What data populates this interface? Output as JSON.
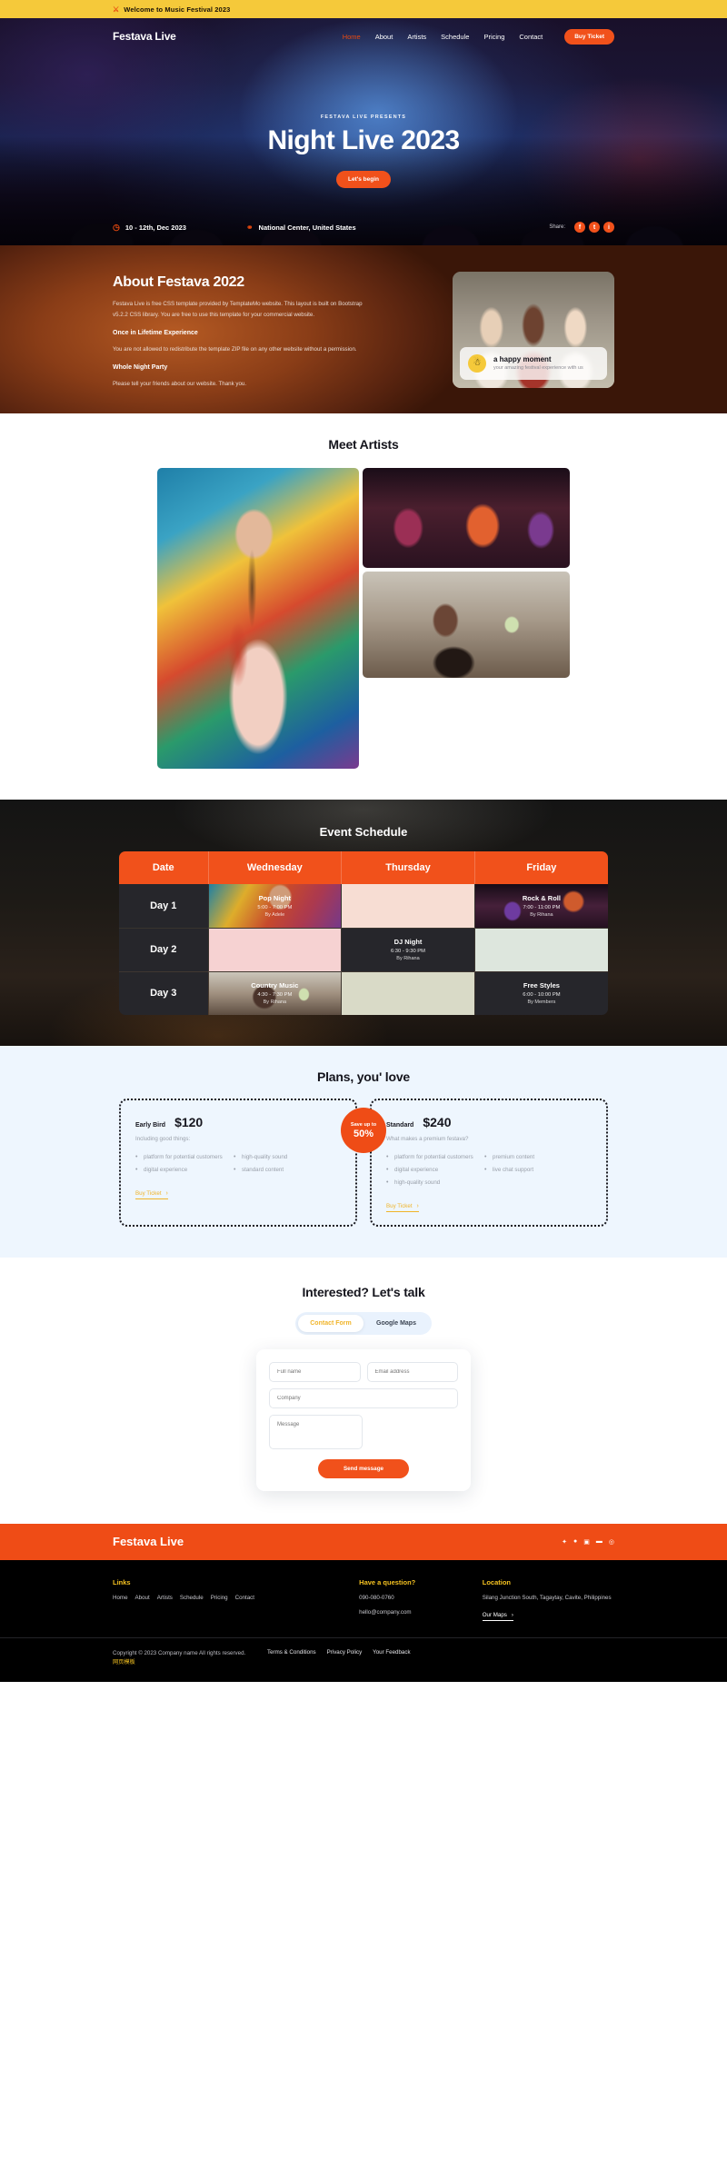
{
  "topbar": {
    "icon": "ticket-icon",
    "text": "Welcome to Music Festival 2023"
  },
  "nav": {
    "brand": "Festava Live",
    "items": [
      {
        "label": "Home",
        "active": true
      },
      {
        "label": "About",
        "active": false
      },
      {
        "label": "Artists",
        "active": false
      },
      {
        "label": "Schedule",
        "active": false
      },
      {
        "label": "Pricing",
        "active": false
      },
      {
        "label": "Contact",
        "active": false
      }
    ],
    "cta": "Buy Ticket"
  },
  "hero": {
    "kicker": "FESTAVA LIVE PRESENTS",
    "title": "Night Live 2023",
    "cta": "Let's begin",
    "date": "10 - 12th, Dec 2023",
    "location": "National Center, United States",
    "share_label": "Share:",
    "socials": [
      "f",
      "t",
      "i"
    ]
  },
  "about": {
    "heading": "About Festava 2022",
    "paragraph": "Festava Live is free CSS template provided by TemplateMo website. This layout is built on Bootstrap v5.2.2 CSS library. You are free to use this template for your commercial website.",
    "sub1_title": "Once in Lifetime Experience",
    "sub1_text": "You are not allowed to redistribute the template ZIP file on any other website without a permission.",
    "sub2_title": "Whole Night Party",
    "sub2_text": "Please tell your friends about our website. Thank you.",
    "card_title": "a happy moment",
    "card_sub": "your amazing festival experience with us",
    "card_icon": "person-icon"
  },
  "artists": {
    "title": "Meet Artists"
  },
  "schedule": {
    "title": "Event Schedule",
    "columns": [
      "Date",
      "Wednesday",
      "Thursday",
      "Friday"
    ],
    "rows": [
      {
        "day": "Day 1",
        "cells": [
          {
            "title": "Pop Night",
            "time": "5:00 - 7:00 PM",
            "by": "By Adele",
            "style": "bg-pop"
          },
          {
            "title": "",
            "time": "",
            "by": "",
            "style": "ph-1"
          },
          {
            "title": "Rock & Roll",
            "time": "7:00 - 11:00 PM",
            "by": "By Rihana",
            "style": "bg-rock"
          }
        ]
      },
      {
        "day": "Day 2",
        "cells": [
          {
            "title": "",
            "time": "",
            "by": "",
            "style": "ph-2"
          },
          {
            "title": "DJ Night",
            "time": "6:30 - 9:30 PM",
            "by": "By Rihana",
            "style": ""
          },
          {
            "title": "",
            "time": "",
            "by": "",
            "style": "ph-3"
          }
        ]
      },
      {
        "day": "Day 3",
        "cells": [
          {
            "title": "Country Music",
            "time": "4:30 - 7:30 PM",
            "by": "By Rihana",
            "style": "bg-country"
          },
          {
            "title": "",
            "time": "",
            "by": "",
            "style": "ph-4"
          },
          {
            "title": "Free Styles",
            "time": "6:00 - 10:00 PM",
            "by": "By Members",
            "style": ""
          }
        ]
      }
    ]
  },
  "pricing": {
    "title": "Plans, you' love",
    "badge_top": "Save up to",
    "badge_value": "50%",
    "plans": [
      {
        "name": "Early Bird",
        "price": "$120",
        "subtitle": "Including good things:",
        "col1": [
          "platform for potential customers",
          "digital experience"
        ],
        "col2": [
          "high-quality sound",
          "standard content"
        ],
        "cta": "Buy Ticket"
      },
      {
        "name": "Standard",
        "price": "$240",
        "subtitle": "What makes a premium festava?",
        "col1": [
          "platform for potential customers",
          "digital experience",
          "high-quality sound"
        ],
        "col2": [
          "premium content",
          "live chat support"
        ],
        "cta": "Buy Ticket"
      }
    ]
  },
  "contact": {
    "title": "Interested? Let's talk",
    "tabs": [
      {
        "label": "Contact Form",
        "active": true
      },
      {
        "label": "Google Maps",
        "active": false
      }
    ],
    "form": {
      "fullname_placeholder": "Full name",
      "email_placeholder": "Email address",
      "company_placeholder": "Company",
      "message_placeholder": "Message",
      "submit": "Send message"
    }
  },
  "footer": {
    "brand": "Festava Live",
    "socials": [
      "twitter-icon",
      "apple-icon",
      "instagram-icon",
      "youtube-icon",
      "pinterest-icon"
    ],
    "links_heading": "Links",
    "links": [
      "Home",
      "About",
      "Artists",
      "Schedule",
      "Pricing",
      "Contact"
    ],
    "question_heading": "Have a question?",
    "phone": "090-080-0760",
    "email": "hello@company.com",
    "location_heading": "Location",
    "address": "Silang Junction South, Tagaytay, Cavite, Philippines",
    "maps_link": "Our Maps",
    "copyright": "Copyright © 2023 Company name All rights reserved.",
    "copyright_zh": "网页模板",
    "legal": [
      "Terms & Conditions",
      "Privacy Policy",
      "Your Feedback"
    ]
  }
}
